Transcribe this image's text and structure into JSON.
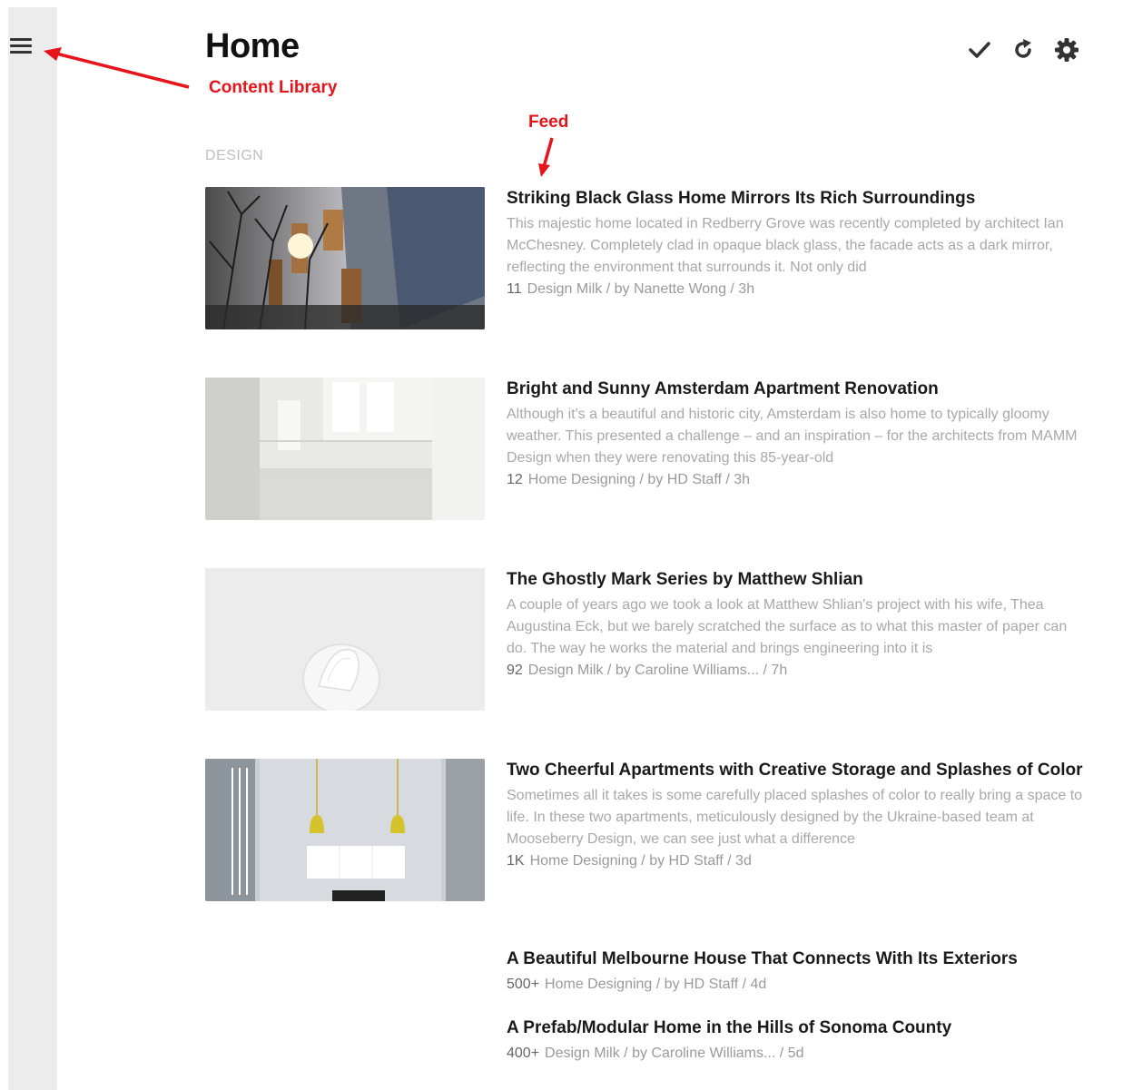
{
  "header": {
    "title": "Home",
    "menu_icon": "hamburger-menu-icon",
    "toolbar": [
      {
        "name": "mark-read",
        "icon": "checkmark-icon"
      },
      {
        "name": "refresh",
        "icon": "refresh-icon"
      },
      {
        "name": "settings",
        "icon": "gear-icon"
      }
    ]
  },
  "annotations": {
    "content_library": "Content Library",
    "feed": "Feed",
    "color": "#e6141b"
  },
  "section": "DESIGN",
  "articles": [
    {
      "title": "Striking Black Glass Home Mirrors Its Rich Surroundings",
      "snippet": "This majestic home located in Redberry Grove was recently completed by architect Ian McChesney. Completely clad in opaque black glass, the facade acts as a dark mirror, reflecting the environment that surrounds it. Not only did",
      "count": "11",
      "meta": "Design Milk / by Nanette Wong / 3h"
    },
    {
      "title": "Bright and Sunny Amsterdam Apartment Renovation",
      "snippet": "Although it's a beautiful and historic city, Amsterdam is also home to typically gloomy weather. This presented a challenge – and an inspiration – for the architects from MAMM Design when they were renovating this 85-year-old",
      "count": "12",
      "meta": "Home Designing / by HD Staff / 3h"
    },
    {
      "title": "The Ghostly Mark Series by Matthew Shlian",
      "snippet": "A couple of years ago we took a look at Matthew Shlian's project with his wife, Thea Augustina Eck, but we barely scratched the surface as to what this master of paper can do. The way he works the material and brings engineering into it is",
      "count": "92",
      "meta": "Design Milk / by Caroline Williams... / 7h"
    },
    {
      "title": "Two Cheerful Apartments with Creative Storage and Splashes of Color",
      "snippet": "Sometimes all it takes is some carefully placed splashes of color to really bring a space to life. In these two apartments, meticulously designed by the Ukraine-based team at Mooseberry Design, we can see just what a difference",
      "count": "1K",
      "meta": "Home Designing / by HD Staff / 3d"
    }
  ],
  "plain_articles": [
    {
      "title": "A Beautiful Melbourne House That Connects With Its Exteriors",
      "count": "500+",
      "meta": "Home Designing / by HD Staff / 4d"
    },
    {
      "title": "A Prefab/Modular Home in the Hills of Sonoma County",
      "count": "400+",
      "meta": "Design Milk / by Caroline Williams... / 5d"
    }
  ]
}
